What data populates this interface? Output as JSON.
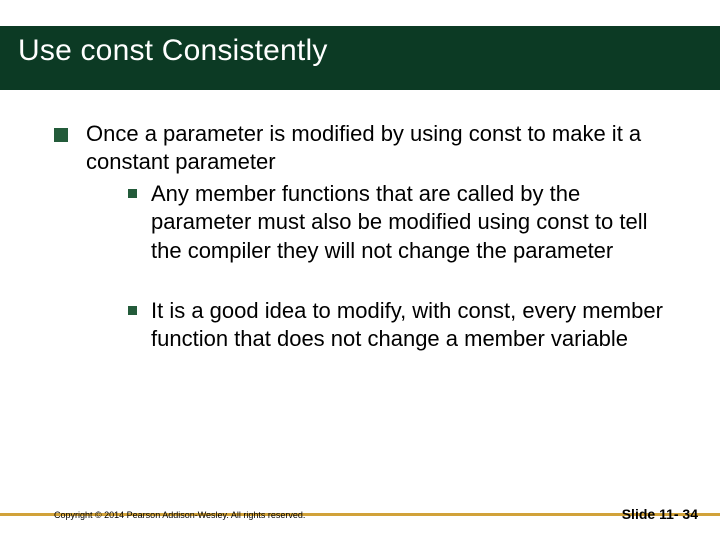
{
  "title": "Use const Consistently",
  "bullets": {
    "b1": "Once a parameter is modified by using const to make it a constant parameter",
    "b1a": "Any member functions that are called by the parameter must also be modified using const to tell the compiler they will not change the parameter",
    "b1b": "It is a good idea to modify, with const,  every member function that does not change a member variable"
  },
  "footer": {
    "copyright": "Copyright © 2014 Pearson Addison-Wesley.  All rights reserved.",
    "slide": "Slide 11- 34"
  }
}
